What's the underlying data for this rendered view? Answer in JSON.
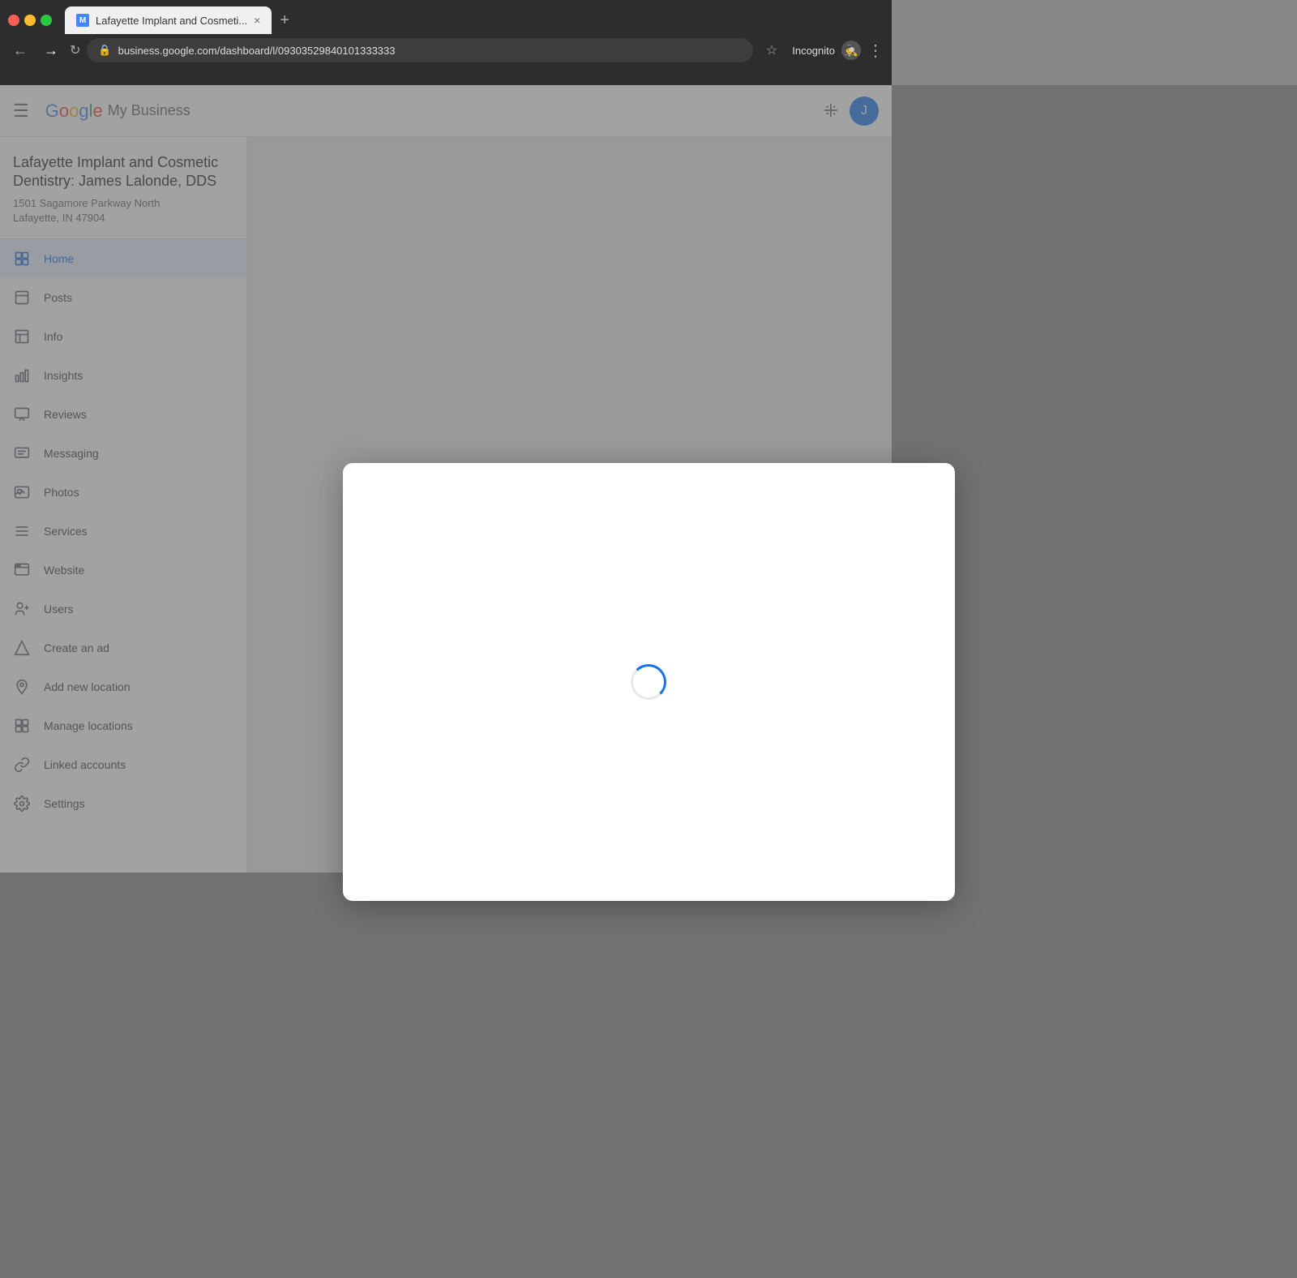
{
  "browser": {
    "tab_label": "Lafayette Implant and Cosmeti...",
    "url": "business.google.com/dashboard/l/09303529840101333333",
    "incognito_label": "Incognito",
    "new_tab_symbol": "+",
    "close_symbol": "×"
  },
  "appbar": {
    "title": "My Business",
    "user_initial": "J"
  },
  "sidebar": {
    "business_name": "Lafayette Implant and Cosmetic Dentistry: James Lalonde, DDS",
    "address_line1": "1501 Sagamore Parkway North",
    "address_line2": "Lafayette, IN 47904",
    "nav_items": [
      {
        "id": "home",
        "label": "Home",
        "icon": "⊞",
        "active": true
      },
      {
        "id": "posts",
        "label": "Posts",
        "icon": "▬"
      },
      {
        "id": "info",
        "label": "Info",
        "icon": "🏢"
      },
      {
        "id": "insights",
        "label": "Insights",
        "icon": "📊"
      },
      {
        "id": "reviews",
        "label": "Reviews",
        "icon": "⭐"
      },
      {
        "id": "messaging",
        "label": "Messaging",
        "icon": "💬"
      },
      {
        "id": "photos",
        "label": "Photos",
        "icon": "🖼"
      },
      {
        "id": "services",
        "label": "Services",
        "icon": "☰"
      },
      {
        "id": "website",
        "label": "Website",
        "icon": "🗔"
      },
      {
        "id": "users",
        "label": "Users",
        "icon": "👤"
      },
      {
        "id": "create-ad",
        "label": "Create an ad",
        "icon": "▲"
      },
      {
        "id": "add-location",
        "label": "Add new location",
        "icon": "📍"
      },
      {
        "id": "manage-location",
        "label": "Manage locations",
        "icon": "⊞"
      },
      {
        "id": "linked-accounts",
        "label": "Linked accounts",
        "icon": "🔗"
      },
      {
        "id": "settings",
        "label": "Settings",
        "icon": "⚙"
      }
    ]
  },
  "colors": {
    "google_blue": "#4285f4",
    "google_red": "#ea4335",
    "google_yellow": "#fbbc05",
    "google_green": "#34a853",
    "active_bg": "#e8f0fe",
    "active_color": "#1a73e8",
    "spinner_color": "#1a73e8"
  }
}
